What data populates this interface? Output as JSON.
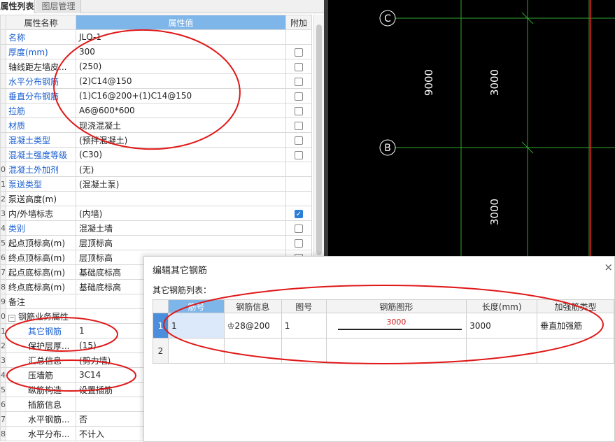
{
  "tabs": {
    "active": "属性列表",
    "inactive": "图层管理"
  },
  "prop_table": {
    "headers": {
      "name": "属性名称",
      "value": "属性值",
      "extra": "附加"
    },
    "rows": [
      {
        "num": "",
        "name": "名称",
        "value": "JLQ-1",
        "blue": true,
        "check": ""
      },
      {
        "num": "",
        "name": "厚度(mm)",
        "value": "300",
        "blue": true,
        "check": "off"
      },
      {
        "num": "",
        "name": "轴线距左墙皮...",
        "value": "(250)",
        "blue": false,
        "check": "off"
      },
      {
        "num": "",
        "name": "水平分布钢筋",
        "value": "(2)C14@150",
        "blue": true,
        "check": "off"
      },
      {
        "num": "",
        "name": "垂直分布钢筋",
        "value": "(1)C16@200+(1)C14@150",
        "blue": true,
        "check": "off"
      },
      {
        "num": "",
        "name": "拉筋",
        "value": "A6@600*600",
        "blue": true,
        "check": "off"
      },
      {
        "num": "",
        "name": "材质",
        "value": "现浇混凝土",
        "blue": true,
        "check": "off"
      },
      {
        "num": "",
        "name": "混凝土类型",
        "value": "(预拌混凝土)",
        "blue": true,
        "check": "off"
      },
      {
        "num": "",
        "name": "混凝土强度等级",
        "value": "(C30)",
        "blue": true,
        "check": "off"
      },
      {
        "num": "0",
        "name": "混凝土外加剂",
        "value": "(无)",
        "blue": true,
        "check": ""
      },
      {
        "num": "1",
        "name": "泵送类型",
        "value": "(混凝土泵)",
        "blue": true,
        "check": ""
      },
      {
        "num": "2",
        "name": "泵送高度(m)",
        "value": "",
        "blue": false,
        "check": ""
      },
      {
        "num": "3",
        "name": "内/外墙标志",
        "value": "(内墙)",
        "blue": false,
        "check": "on"
      },
      {
        "num": "4",
        "name": "类别",
        "value": "混凝土墙",
        "blue": true,
        "check": "off"
      },
      {
        "num": "5",
        "name": "起点顶标高(m)",
        "value": "层顶标高",
        "blue": false,
        "check": "off"
      },
      {
        "num": "6",
        "name": "终点顶标高(m)",
        "value": "层顶标高",
        "blue": false,
        "check": "off"
      },
      {
        "num": "7",
        "name": "起点底标高(m)",
        "value": "基础底标高",
        "blue": false,
        "check": "off"
      },
      {
        "num": "8",
        "name": "终点底标高(m)",
        "value": "基础底标高",
        "blue": false,
        "check": "off"
      },
      {
        "num": "9",
        "name": "备注",
        "value": "",
        "blue": false,
        "check": ""
      },
      {
        "num": "0",
        "name": "钢筋业务属性",
        "value": "",
        "blue": false,
        "check": "",
        "group": true
      },
      {
        "num": "1",
        "name": "其它钢筋",
        "value": "1",
        "blue": true,
        "check": "",
        "sub": true
      },
      {
        "num": "2",
        "name": "保护层厚...",
        "value": "(15)",
        "blue": false,
        "check": "",
        "sub": true
      },
      {
        "num": "3",
        "name": "汇总信息",
        "value": "(剪力墙)",
        "blue": false,
        "check": "",
        "sub": true
      },
      {
        "num": "4",
        "name": "压墙筋",
        "value": "3C14",
        "blue": false,
        "check": "",
        "sub": true
      },
      {
        "num": "5",
        "name": "纵筋构造",
        "value": "设置插筋",
        "blue": false,
        "check": "",
        "sub": true
      },
      {
        "num": "6",
        "name": "插筋信息",
        "value": "",
        "blue": false,
        "check": "",
        "sub": true
      },
      {
        "num": "7",
        "name": "水平钢筋...",
        "value": "否",
        "blue": false,
        "check": "",
        "sub": true
      },
      {
        "num": "8",
        "name": "水平分布...",
        "value": "不计入",
        "blue": false,
        "check": "",
        "sub": true
      }
    ]
  },
  "cad": {
    "axis_c": "C",
    "axis_b": "B",
    "dims": {
      "d9000": "9000",
      "d3000a": "3000",
      "d3000b": "3000"
    },
    "colors": {
      "bg": "#000000",
      "grid": "#2fa82f",
      "red": "#e02020",
      "text": "#ffffff"
    }
  },
  "dialog": {
    "title": "编辑其它钢筋",
    "close": "×",
    "subtitle": "其它钢筋列表：",
    "headers": [
      "筋号",
      "钢筋信息",
      "图号",
      "钢筋图形",
      "长度(mm)",
      "加强筋类型"
    ],
    "rows": [
      {
        "row": "1",
        "bar_no": "1",
        "info": "♔28@200",
        "fig_no": "1",
        "shape_len": "3000",
        "length": "3000",
        "type": "垂直加强筋"
      },
      {
        "row": "2",
        "bar_no": "",
        "info": "",
        "fig_no": "",
        "shape_len": "",
        "length": "",
        "type": ""
      }
    ]
  }
}
